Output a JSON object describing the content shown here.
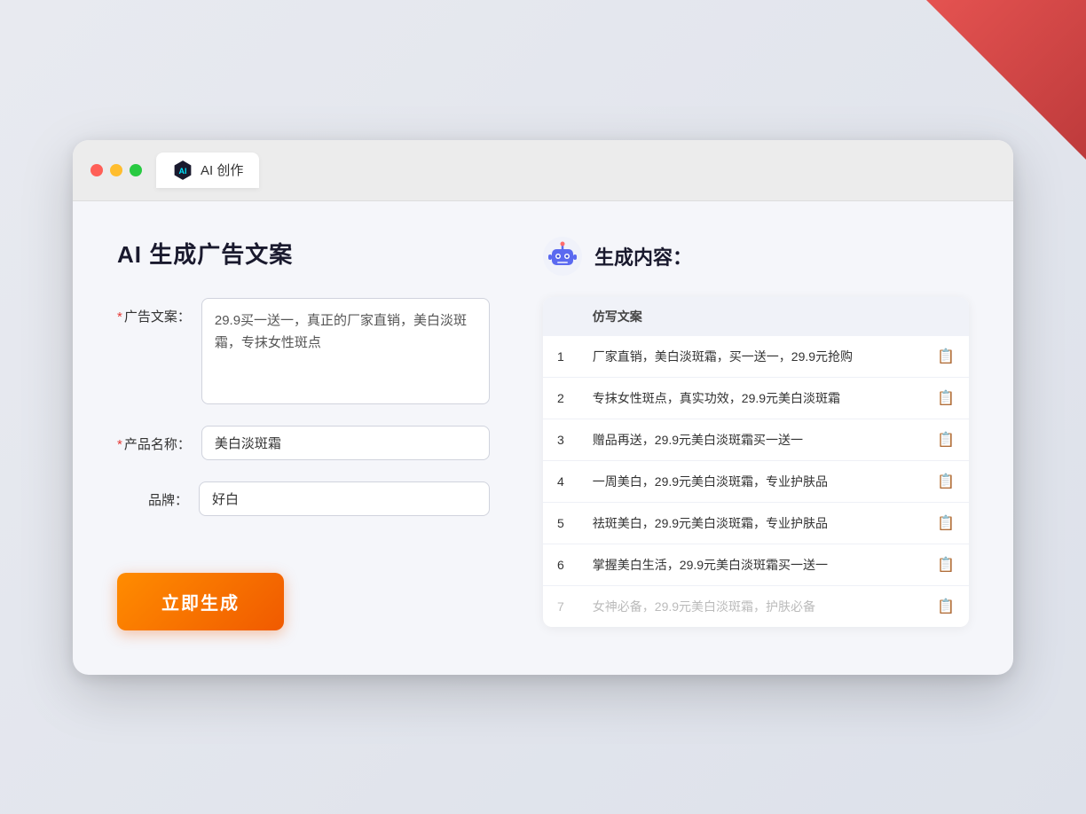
{
  "deco": {
    "dots": [
      1,
      2,
      3,
      4,
      5,
      6,
      7,
      8,
      9,
      10,
      11,
      12
    ]
  },
  "browser": {
    "tab_label": "AI 创作"
  },
  "left": {
    "page_title": "AI 生成广告文案",
    "form": {
      "ad_copy_label": "广告文案：",
      "ad_copy_required": "*",
      "ad_copy_value": "29.9买一送一，真正的厂家直销，美白淡斑霜，专抹女性斑点",
      "product_name_label": "产品名称：",
      "product_name_required": "*",
      "product_name_value": "美白淡斑霜",
      "brand_label": "品牌：",
      "brand_value": "好白"
    },
    "generate_btn": "立即生成"
  },
  "right": {
    "header_title": "生成内容：",
    "table": {
      "column_header": "仿写文案",
      "rows": [
        {
          "num": "1",
          "text": "厂家直销，美白淡斑霜，买一送一，29.9元抢购",
          "dimmed": false
        },
        {
          "num": "2",
          "text": "专抹女性斑点，真实功效，29.9元美白淡斑霜",
          "dimmed": false
        },
        {
          "num": "3",
          "text": "赠品再送，29.9元美白淡斑霜买一送一",
          "dimmed": false
        },
        {
          "num": "4",
          "text": "一周美白，29.9元美白淡斑霜，专业护肤品",
          "dimmed": false
        },
        {
          "num": "5",
          "text": "祛斑美白，29.9元美白淡斑霜，专业护肤品",
          "dimmed": false
        },
        {
          "num": "6",
          "text": "掌握美白生活，29.9元美白淡斑霜买一送一",
          "dimmed": false
        },
        {
          "num": "7",
          "text": "女神必备，29.9元美白淡斑霜，护肤必备",
          "dimmed": true
        }
      ]
    }
  }
}
